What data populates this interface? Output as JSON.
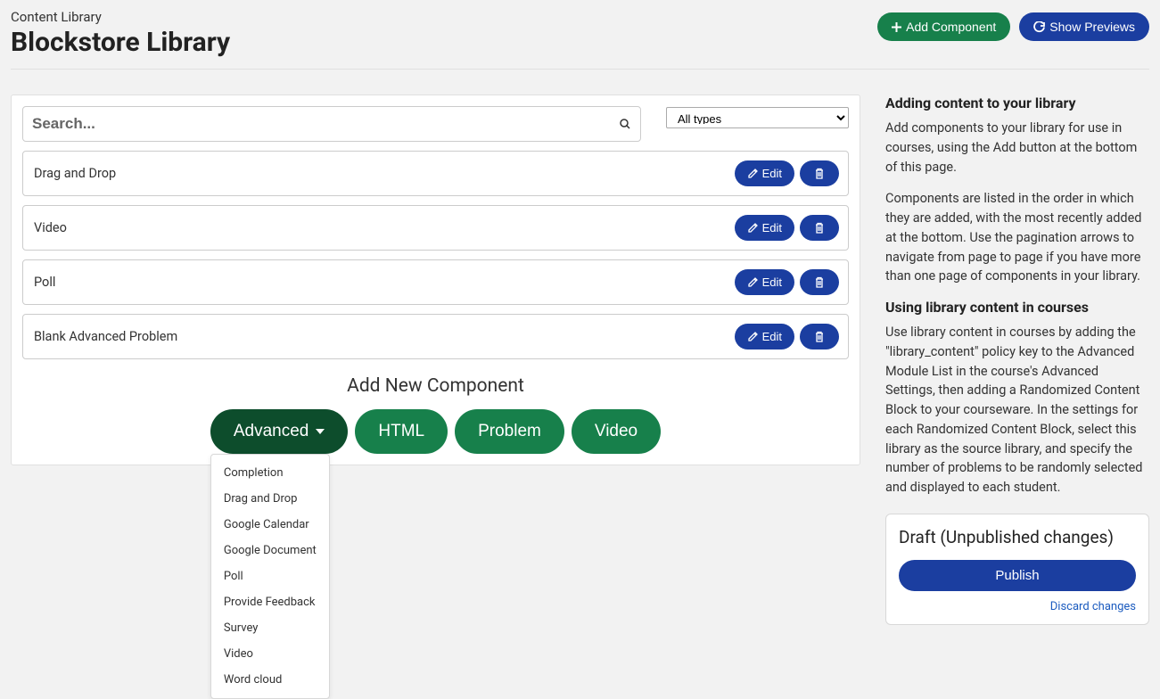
{
  "header": {
    "breadcrumb": "Content Library",
    "title": "Blockstore Library",
    "add_component_label": "Add Component",
    "show_previews_label": "Show Previews"
  },
  "search": {
    "placeholder": "Search...",
    "type_filter_selected": "All types"
  },
  "components": [
    {
      "name": "Drag and Drop"
    },
    {
      "name": "Video"
    },
    {
      "name": "Poll"
    },
    {
      "name": "Blank Advanced Problem"
    }
  ],
  "component_actions": {
    "edit_label": "Edit"
  },
  "add_new": {
    "title": "Add New Component",
    "buttons": {
      "advanced": "Advanced",
      "html": "HTML",
      "problem": "Problem",
      "video": "Video"
    },
    "advanced_menu": [
      "Completion",
      "Drag and Drop",
      "Google Calendar",
      "Google Document",
      "Poll",
      "Provide Feedback",
      "Survey",
      "Video",
      "Word cloud"
    ]
  },
  "sidebar": {
    "heading1": "Adding content to your library",
    "p1": "Add components to your library for use in courses, using the Add button at the bottom of this page.",
    "p2": "Components are listed in the order in which they are added, with the most recently added at the bottom. Use the pagination arrows to navigate from page to page if you have more than one page of components in your library.",
    "heading2": "Using library content in courses",
    "p3": "Use library content in courses by adding the \"library_content\" policy key to the Advanced Module List in the course's Advanced Settings, then adding a Randomized Content Block to your courseware. In the settings for each Randomized Content Block, select this library as the source library, and specify the number of problems to be randomly selected and displayed to each student."
  },
  "publish": {
    "status": "Draft (Unpublished changes)",
    "publish_label": "Publish",
    "discard_label": "Discard changes"
  }
}
